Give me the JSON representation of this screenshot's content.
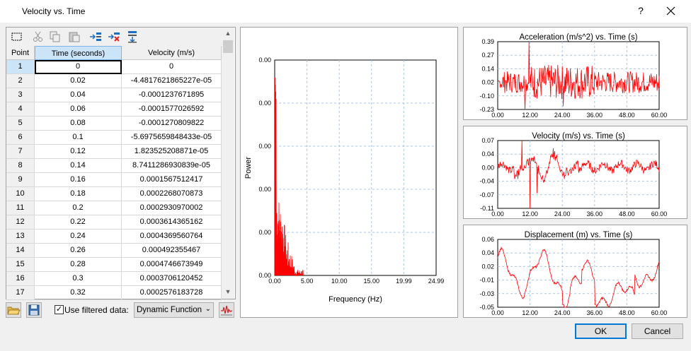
{
  "window": {
    "title": "Velocity vs. Time",
    "help": "?"
  },
  "table": {
    "headers": [
      "Point",
      "Time (seconds)",
      "Velocity (m/s)"
    ],
    "rows": [
      [
        "1",
        "0",
        "0"
      ],
      [
        "2",
        "0.02",
        "-4.4817621865227e-05"
      ],
      [
        "3",
        "0.04",
        "-0.0001237671895"
      ],
      [
        "4",
        "0.06",
        "-0.0001577026592"
      ],
      [
        "5",
        "0.08",
        "-0.0001270809822"
      ],
      [
        "6",
        "0.1",
        "-5.6975659848433e-05"
      ],
      [
        "7",
        "0.12",
        "1.823525208871e-05"
      ],
      [
        "8",
        "0.14",
        "8.7411286930839e-05"
      ],
      [
        "9",
        "0.16",
        "0.0001567512417"
      ],
      [
        "10",
        "0.18",
        "0.0002268070873"
      ],
      [
        "11",
        "0.2",
        "0.0002930970002"
      ],
      [
        "12",
        "0.22",
        "0.0003614365162"
      ],
      [
        "13",
        "0.24",
        "0.0004369560764"
      ],
      [
        "14",
        "0.26",
        "0.000492355467"
      ],
      [
        "15",
        "0.28",
        "0.0004746673949"
      ],
      [
        "16",
        "0.3",
        "0.0003706120452"
      ],
      [
        "17",
        "0.32",
        "0.0002576183728"
      ]
    ],
    "selected_row": 1
  },
  "toolbar": {
    "icons": [
      "select-all-icon",
      "cut-icon",
      "copy-icon",
      "paste-icon",
      "insert-row-icon",
      "delete-row-icon",
      "append-row-icon"
    ]
  },
  "bottom": {
    "filter_label": "Use filtered data:",
    "filter_checked": true,
    "function_value": "Dynamic Function :"
  },
  "chart_data": [
    {
      "type": "line",
      "xlabel": "Frequency (Hz)",
      "ylabel": "Power",
      "xticks": [
        "0.00",
        "5.00",
        "10.00",
        "15.00",
        "19.99",
        "24.99"
      ],
      "yticks": [
        "0.00",
        "0.00",
        "0.00",
        "0.00",
        "0.00",
        "0.00"
      ],
      "xlim": [
        0,
        24.99
      ],
      "grid": true,
      "color": "#ff0000"
    },
    {
      "type": "line",
      "title": "Acceleration (m/s^2) vs. Time (s)",
      "xticks": [
        "0.00",
        "12.00",
        "24.00",
        "36.00",
        "48.00",
        "60.00"
      ],
      "yticks": [
        "0.39",
        "0.27",
        "0.14",
        "0.02",
        "-0.10",
        "-0.23"
      ],
      "xlim": [
        0,
        60
      ],
      "ylim": [
        -0.23,
        0.39
      ],
      "grid": true,
      "color": "#ff0000"
    },
    {
      "type": "line",
      "title": "Velocity (m/s) vs. Time (s)",
      "xticks": [
        "0.00",
        "12.00",
        "24.00",
        "36.00",
        "48.00",
        "60.00"
      ],
      "yticks": [
        "0.07",
        "0.04",
        "0.00",
        "-0.04",
        "-0.07",
        "-0.11"
      ],
      "xlim": [
        0,
        60
      ],
      "ylim": [
        -0.11,
        0.07
      ],
      "grid": true,
      "color": "#ff0000"
    },
    {
      "type": "line",
      "title": "Displacement (m) vs. Time (s)",
      "xticks": [
        "0.00",
        "12.00",
        "24.00",
        "36.00",
        "48.00",
        "60.00"
      ],
      "yticks": [
        "0.06",
        "0.04",
        "0.02",
        "-0.01",
        "-0.03",
        "-0.05"
      ],
      "xlim": [
        0,
        60
      ],
      "ylim": [
        -0.05,
        0.06
      ],
      "grid": true,
      "color": "#ff0000"
    }
  ],
  "buttons": {
    "ok": "OK",
    "cancel": "Cancel"
  }
}
